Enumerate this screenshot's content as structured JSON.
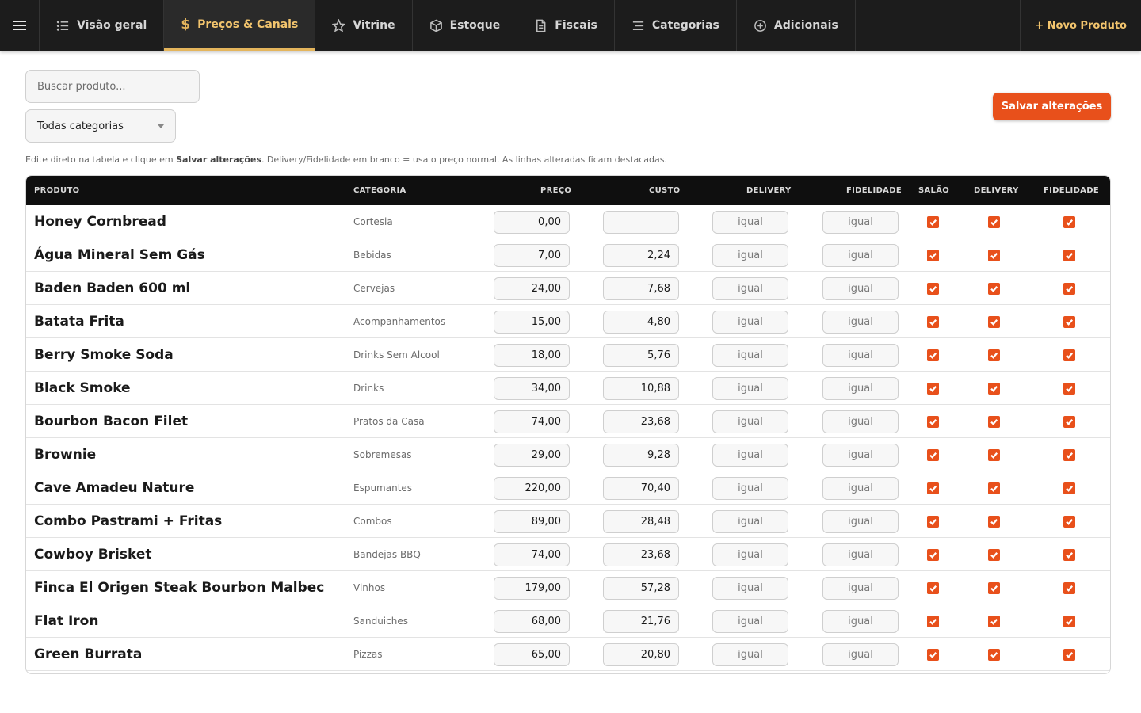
{
  "nav": {
    "tabs": [
      {
        "label": "Visão geral",
        "icon": "list-icon",
        "active": false
      },
      {
        "label": "Preços & Canais",
        "icon": "dollar-icon",
        "active": true
      },
      {
        "label": "Vitrine",
        "icon": "star-icon",
        "active": false
      },
      {
        "label": "Estoque",
        "icon": "box-icon",
        "active": false
      },
      {
        "label": "Fiscais",
        "icon": "document-icon",
        "active": false
      },
      {
        "label": "Categorias",
        "icon": "categories-icon",
        "active": false
      },
      {
        "label": "Adicionais",
        "icon": "plus-circle-icon",
        "active": false
      }
    ],
    "new_product": "+ Novo Produto"
  },
  "filters": {
    "search_placeholder": "Buscar produto...",
    "category_selected": "Todas categorias"
  },
  "save_label": "Salvar alterações",
  "hint": {
    "before": "Edite direto na tabela e clique em ",
    "bold": "Salvar alterações",
    "after": ". Delivery/Fidelidade em branco = usa o preço normal. As linhas alteradas ficam destacadas."
  },
  "table": {
    "headers": {
      "produto": "PRODUTO",
      "categoria": "CATEGORIA",
      "preco": "PREÇO",
      "custo": "CUSTO",
      "delivery": "DELIVERY",
      "fidelidade": "FIDELIDADE",
      "salao": "SALÃO",
      "delivery_chk": "DELIVERY",
      "fidelidade_chk": "FIDELIDADE"
    },
    "price_placeholder": "igual",
    "rows": [
      {
        "name": "Honey Cornbread",
        "category": "Cortesia",
        "price": "0,00",
        "cost": "",
        "salao": true,
        "delivery": true,
        "fidelidade": true
      },
      {
        "name": "Água Mineral Sem Gás",
        "category": "Bebidas",
        "price": "7,00",
        "cost": "2,24",
        "salao": true,
        "delivery": true,
        "fidelidade": true
      },
      {
        "name": "Baden Baden 600 ml",
        "category": "Cervejas",
        "price": "24,00",
        "cost": "7,68",
        "salao": true,
        "delivery": true,
        "fidelidade": true
      },
      {
        "name": "Batata Frita",
        "category": "Acompanhamentos",
        "price": "15,00",
        "cost": "4,80",
        "salao": true,
        "delivery": true,
        "fidelidade": true
      },
      {
        "name": "Berry Smoke Soda",
        "category": "Drinks Sem Alcool",
        "price": "18,00",
        "cost": "5,76",
        "salao": true,
        "delivery": true,
        "fidelidade": true
      },
      {
        "name": "Black Smoke",
        "category": "Drinks",
        "price": "34,00",
        "cost": "10,88",
        "salao": true,
        "delivery": true,
        "fidelidade": true
      },
      {
        "name": "Bourbon Bacon Filet",
        "category": "Pratos da Casa",
        "price": "74,00",
        "cost": "23,68",
        "salao": true,
        "delivery": true,
        "fidelidade": true
      },
      {
        "name": "Brownie",
        "category": "Sobremesas",
        "price": "29,00",
        "cost": "9,28",
        "salao": true,
        "delivery": true,
        "fidelidade": true
      },
      {
        "name": "Cave Amadeu Nature",
        "category": "Espumantes",
        "price": "220,00",
        "cost": "70,40",
        "salao": true,
        "delivery": true,
        "fidelidade": true
      },
      {
        "name": "Combo Pastrami + Fritas",
        "category": "Combos",
        "price": "89,00",
        "cost": "28,48",
        "salao": true,
        "delivery": true,
        "fidelidade": true
      },
      {
        "name": "Cowboy Brisket",
        "category": "Bandejas BBQ",
        "price": "74,00",
        "cost": "23,68",
        "salao": true,
        "delivery": true,
        "fidelidade": true
      },
      {
        "name": "Finca El Origen Steak Bourbon Malbec",
        "category": "Vinhos",
        "price": "179,00",
        "cost": "57,28",
        "salao": true,
        "delivery": true,
        "fidelidade": true
      },
      {
        "name": "Flat Iron",
        "category": "Sanduiches",
        "price": "68,00",
        "cost": "21,76",
        "salao": true,
        "delivery": true,
        "fidelidade": true
      },
      {
        "name": "Green Burrata",
        "category": "Pizzas",
        "price": "65,00",
        "cost": "20,80",
        "salao": true,
        "delivery": true,
        "fidelidade": true
      }
    ]
  }
}
